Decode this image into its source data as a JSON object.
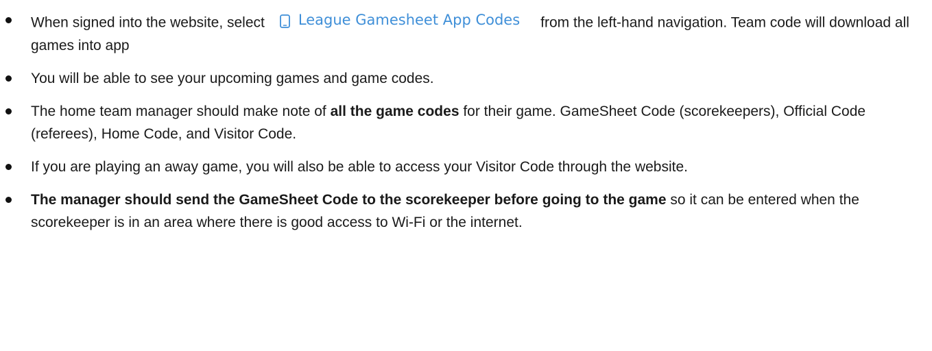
{
  "bullets": [
    {
      "before": "When signed into the website, select",
      "nav_label": "League Gamesheet App Codes",
      "after": "from the left-hand navigation. Team code will download all games into app"
    },
    {
      "text": "You will be able to see your upcoming games and game codes."
    },
    {
      "before": "The home team manager should make note of ",
      "bold": "all the game codes",
      "after": " for their game. GameSheet Code (scorekeepers), Official Code (referees), Home Code, and Visitor Code."
    },
    {
      "text": "If you are playing an away game, you will also be able to access your Visitor Code through the website."
    },
    {
      "bold": "The manager should send the GameSheet Code to the scorekeeper before going to the game",
      "after": " so it can be entered when the scorekeeper is in an area where there is good access to Wi-Fi or the internet."
    }
  ],
  "colors": {
    "link": "#3f8fd8",
    "text": "#1a1a1a"
  },
  "icons": {
    "nav_link_icon": "mobile-phone-icon"
  }
}
